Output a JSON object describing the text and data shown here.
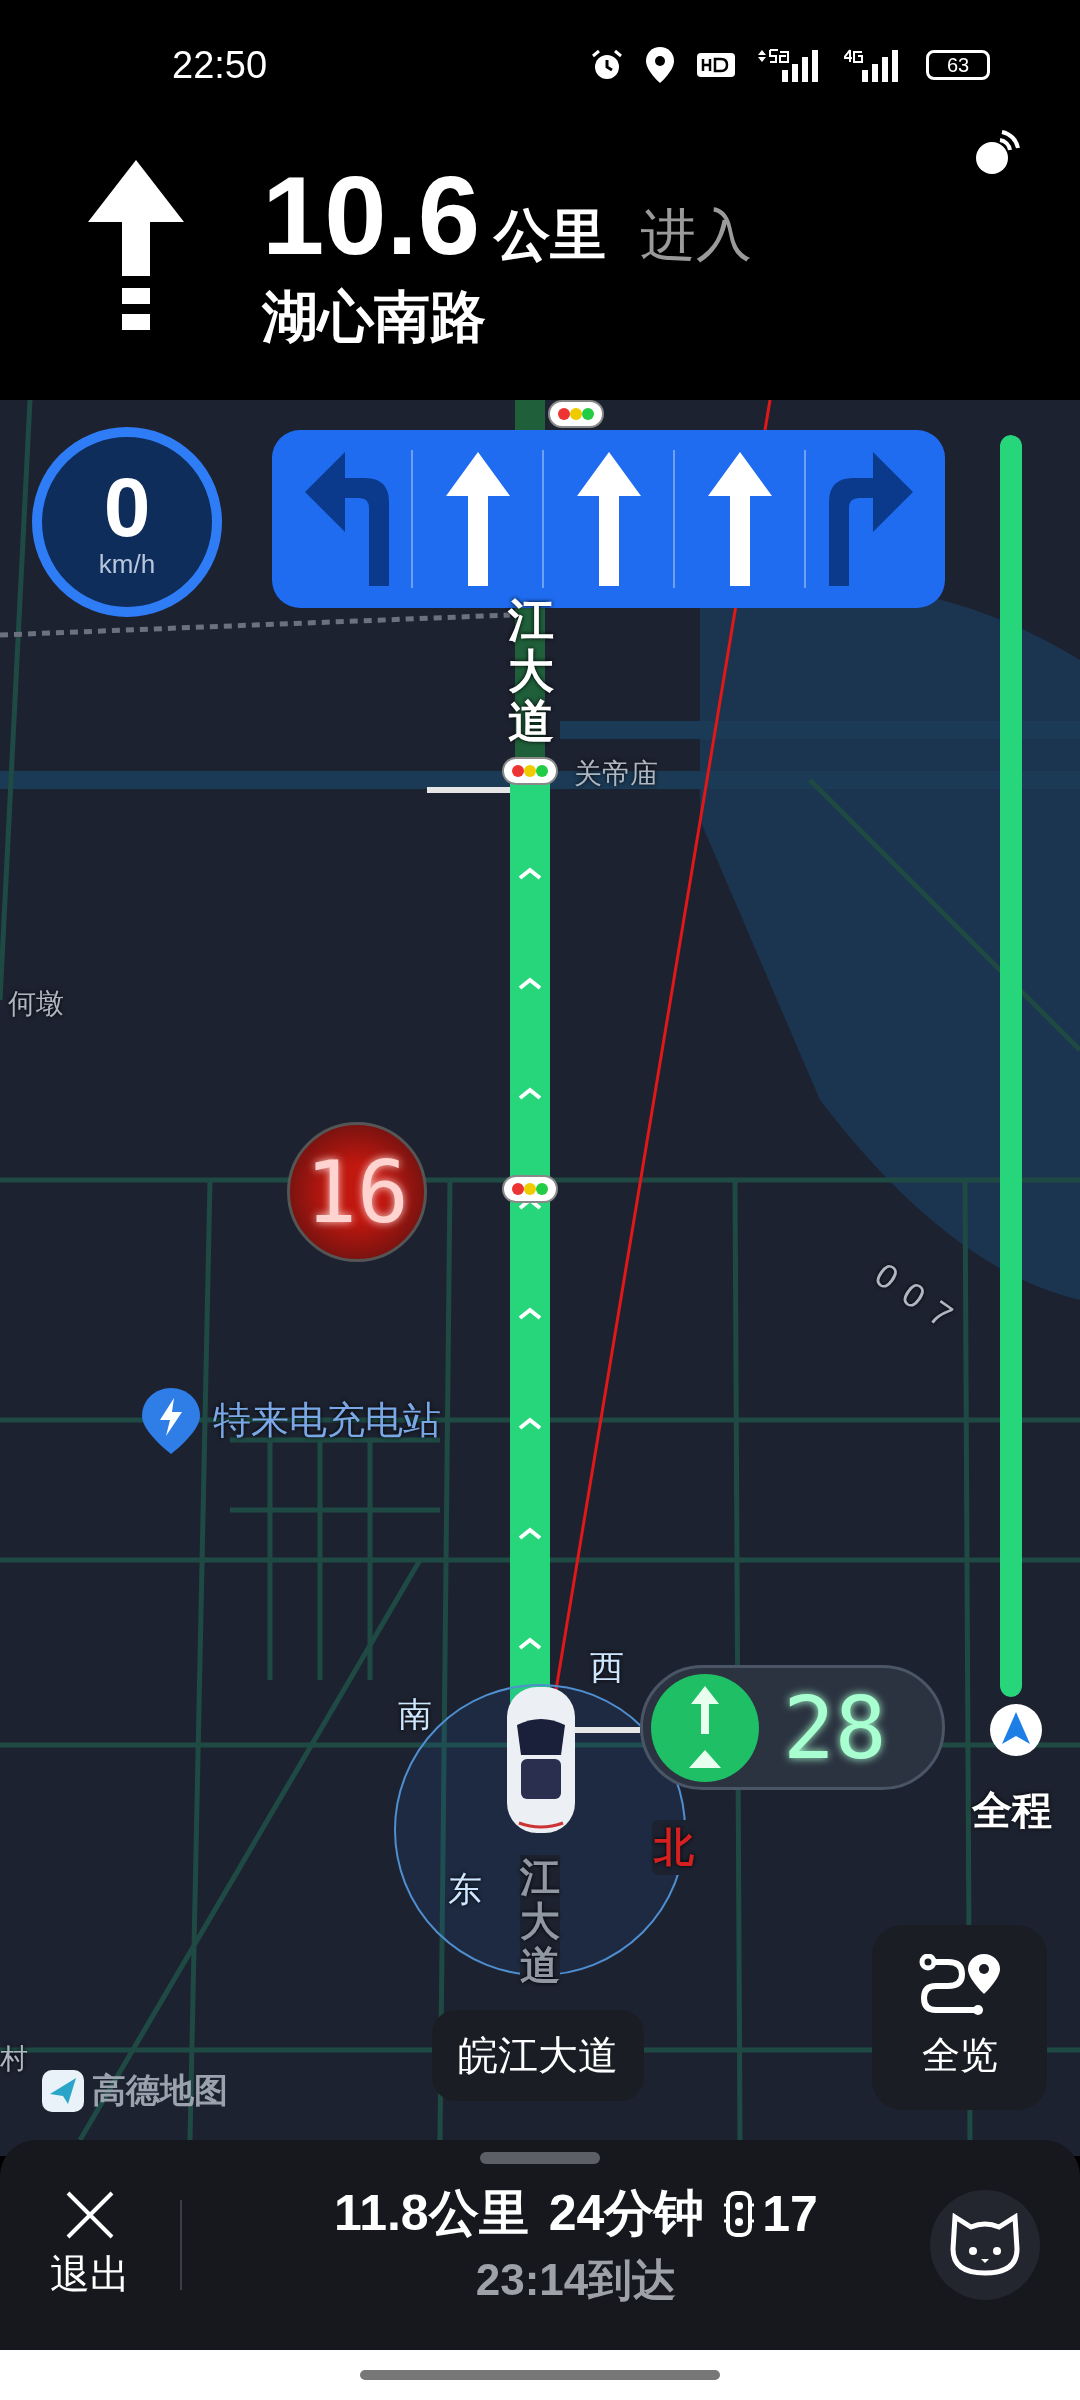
{
  "status_bar": {
    "time": "22:50",
    "battery": "63"
  },
  "guidance": {
    "distance": "10.6",
    "unit": "公里",
    "action": "进入",
    "road": "湖心南路"
  },
  "speed": {
    "value": "0",
    "unit": "km/h"
  },
  "lanes": [
    {
      "kind": "left",
      "recommended": false
    },
    {
      "kind": "straight",
      "recommended": true
    },
    {
      "kind": "straight",
      "recommended": true
    },
    {
      "kind": "straight",
      "recommended": true
    },
    {
      "kind": "right",
      "recommended": false
    }
  ],
  "map": {
    "road_name_ahead": "江大道",
    "landmark": "关帝庙",
    "village": "何墩",
    "village_edge": "村",
    "charging_station": "特来电充电站",
    "side_road": "007",
    "road_name_below": "江大道",
    "compass": {
      "west": "西",
      "south": "南",
      "east": "东",
      "north": "北"
    },
    "countdowns": [
      {
        "kind": "circle",
        "seconds": "16",
        "color": "#c0170f"
      },
      {
        "kind": "pill",
        "seconds": "28",
        "color": "#1fbf66"
      }
    ],
    "current_road": "皖江大道",
    "route_progress": {
      "level": 1
    },
    "overview_button": "全览",
    "route_overview": "全程",
    "brand": "高德地图"
  },
  "trip": {
    "exit": "退出",
    "distance": "11.8公里",
    "duration": "24分钟",
    "traffic_lights": "17",
    "arrival": "23:14到达"
  }
}
